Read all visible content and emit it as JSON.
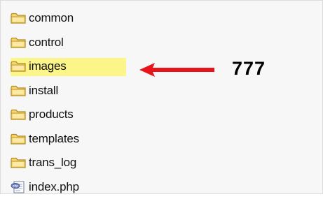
{
  "folders": [
    {
      "label": "common",
      "icon": "folder-icon",
      "highlighted": false
    },
    {
      "label": "control",
      "icon": "folder-icon",
      "highlighted": false
    },
    {
      "label": "images",
      "icon": "folder-icon",
      "highlighted": true
    },
    {
      "label": "install",
      "icon": "folder-icon",
      "highlighted": false
    },
    {
      "label": "products",
      "icon": "folder-icon",
      "highlighted": false
    },
    {
      "label": "templates",
      "icon": "folder-icon",
      "highlighted": false
    },
    {
      "label": "trans_log",
      "icon": "folder-icon",
      "highlighted": false
    },
    {
      "label": "index.php",
      "icon": "php-file-icon",
      "highlighted": false
    }
  ],
  "annotation": {
    "text": "777",
    "arrow_icon": "arrow-left-icon",
    "arrow_color": "#e8141b"
  },
  "colors": {
    "highlight": "#fbf58a",
    "folder_body": "#f6d576",
    "folder_outline": "#b08a1a"
  }
}
